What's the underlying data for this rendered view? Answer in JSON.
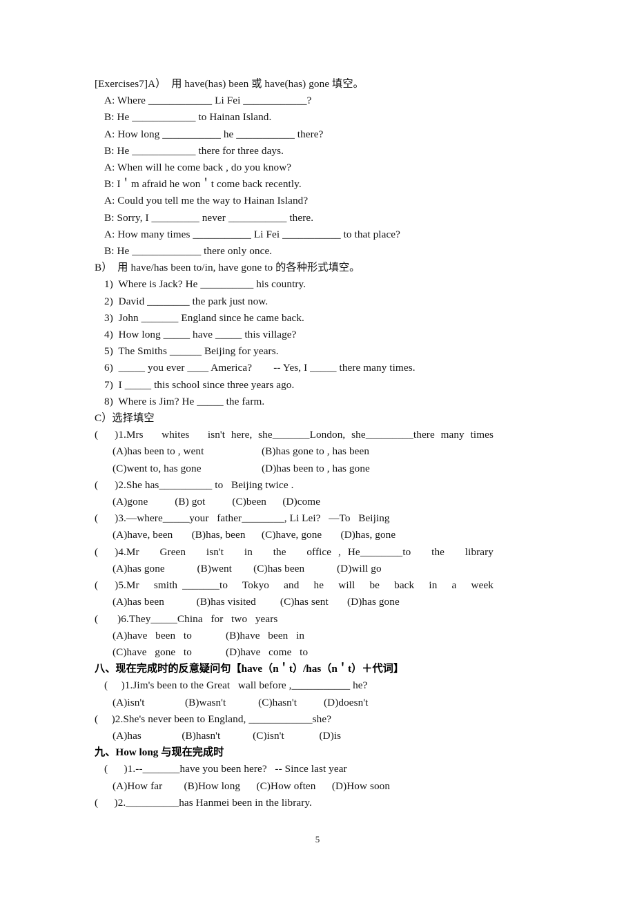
{
  "page": {
    "number": "5",
    "background_color": "#ffffff",
    "text_color": "#000000"
  },
  "sections": [
    {
      "id": "exercises7-A",
      "heading": "[Exercises7]A）  用 have(has) been 或 have(has) gone 填空。",
      "lines": [
        "A: Where ____________ Li Fei ____________?",
        "B: He ____________ to Hainan Island.",
        "A: How long ___________ he ___________ there?",
        "B: He ____________ there for three days.",
        "A: When will he come back , do you know?",
        "B: I＇m afraid he won＇t come back recently.",
        "A: Could you tell me the way to Hainan Island?",
        "B: Sorry, I _________ never ___________ there.",
        "A: How many times ___________ Li Fei ___________ to that place?",
        "B: He _____________ there only once."
      ]
    },
    {
      "id": "exercises7-B",
      "heading": "B）  用 have/has been to/in, have gone to 的各种形式填空。",
      "items": [
        "1)  Where is Jack? He __________ his country.",
        "2)  David ________ the park just now.",
        "3)  John _______ England since he came back.",
        "4)  How long _____ have _____ this village?",
        "5)  The Smiths ______ Beijing for years.",
        "6)  _____ you ever ____ America?        -- Yes, I _____ there many times.",
        "7)  I _____ this school since three years ago.",
        "8)  Where is Jim? He _____ the farm."
      ]
    },
    {
      "id": "exercises7-C",
      "heading": "C）选择填空",
      "questions": [
        {
          "stem_paren": "(",
          "stem": ")1.Mrs   whites   isn't here, she_______London, she_________there many times",
          "justify": true,
          "option_rows": [
            {
              "left": "(A)has been to , went",
              "right": "(B)has gone to , has been"
            },
            {
              "left": "(C)went to, has gone",
              "right": "(D)has been to , has gone"
            }
          ]
        },
        {
          "stem_paren": "(",
          "stem": ")2.She has__________ to   Beijing twice .",
          "justify": false,
          "options_inline": "(A)gone          (B) got          (C)been      (D)come"
        },
        {
          "stem_paren": "(",
          "stem": ")3.—where_____your   father________, Li Lei?   —To   Beijing",
          "justify": false,
          "options_inline": "(A)have, been       (B)has, been      (C)have, gone       (D)has, gone"
        },
        {
          "stem_paren": "(",
          "stem": ")4.Mr   Green   isn't   in   the   office , He________to   the   library",
          "justify": true,
          "options_inline": "(A)has gone            (B)went        (C)has been            (D)will go"
        },
        {
          "stem_paren": "(",
          "stem": ")5.Mr   smith _______to   Tokyo   and   he   will   be   back   in   a   week",
          "justify": true,
          "options_inline": "(A)has been            (B)has visited         (C)has sent       (D)has gone"
        },
        {
          "stem_paren": "(",
          "stem": " )6.They_____China   for   two   years",
          "justify": false,
          "option_rows": [
            {
              "left": "(A)have   been   to",
              "right": "(B)have   been   in"
            },
            {
              "left": "(C)have   gone   to",
              "right": "(D)have   come   to"
            }
          ]
        }
      ]
    },
    {
      "id": "section-eight",
      "heading": "八、现在完成时的反意疑问句【have（n＇t）/has（n＇t）＋代词】",
      "bold": true,
      "questions": [
        {
          "stem": "(     )1.Jim's been to the Great   wall before ,___________ he?",
          "options_inline": "(A)isn't               (B)wasn't            (C)hasn't          (D)doesn't"
        },
        {
          "stem": "(     )2.She's never been to England, ____________she?",
          "options_inline": "(A)has               (B)hasn't            (C)isn't             (D)is"
        }
      ]
    },
    {
      "id": "section-nine",
      "heading": "九、How long 与现在完成时",
      "bold": true,
      "heading_bold_segment": "How long",
      "questions": [
        {
          "stem": "(      )1.--_______have you been here?   -- Since last year",
          "options_inline": "(A)How far        (B)How long      (C)How often      (D)How soon"
        },
        {
          "stem": "(      )2.__________has Hanmei been in the library.",
          "options_inline": ""
        }
      ]
    }
  ]
}
